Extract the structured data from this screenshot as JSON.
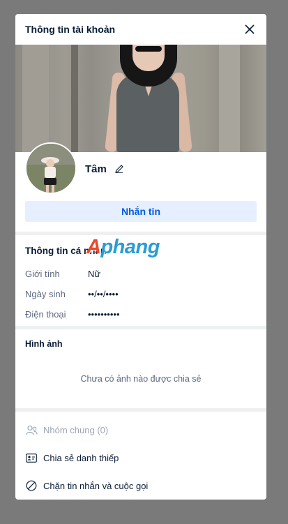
{
  "header": {
    "title": "Thông tin tài khoản"
  },
  "profile": {
    "name": "Tâm"
  },
  "message_button": {
    "label": "Nhắn tin"
  },
  "personal_info": {
    "title": "Thông tin cá nhân",
    "rows": [
      {
        "label": "Giới tính",
        "value": "Nữ"
      },
      {
        "label": "Ngày sinh",
        "value": "••/••/••••"
      },
      {
        "label": "Điện thoại",
        "value": "••••••••••"
      }
    ]
  },
  "images": {
    "title": "Hình ảnh",
    "empty_text": "Chưa có ảnh nào được chia sẻ"
  },
  "actions": {
    "common_groups": "Nhóm chung (0)",
    "share_card": "Chia sẻ danh thiếp",
    "block": "Chặn tin nhắn và cuộc gọi"
  },
  "watermark": {
    "first_letter": "A",
    "rest": "phang"
  },
  "colors": {
    "accent": "#005ae0",
    "overlay": "#7a7a7a"
  }
}
